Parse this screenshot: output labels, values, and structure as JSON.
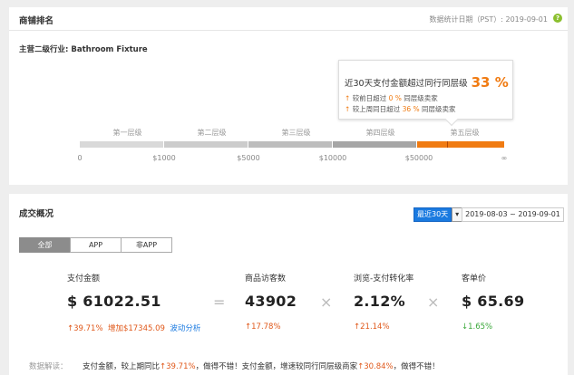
{
  "shop_rank": {
    "title": "商铺排名",
    "stat_date": "数据统计日期（PST）: 2019-09-01",
    "industry": "主营二级行业: Bathroom Fixture",
    "popup": {
      "main": "近30天支付金额超过同行同层级",
      "pct": "33 %",
      "line1_prefix": "较前日超过",
      "line1_pct": "0 %",
      "line1_suffix": "同层级卖家",
      "line2_prefix": "较上周同日超过",
      "line2_pct": "36 %",
      "line2_suffix": "同层级卖家"
    },
    "tiers": [
      "第一层级",
      "第二层级",
      "第三层级",
      "第四层级",
      "第五层级"
    ],
    "tier_colors": [
      "#d9d9d9",
      "#cccccc",
      "#bdbdbd",
      "#a6a6a6",
      "#f07b12"
    ],
    "active_tier": "第五层级",
    "ticks": [
      "0",
      "$1000",
      "$5000",
      "$10000",
      "$50000",
      "∞"
    ]
  },
  "deal": {
    "title": "成交概况",
    "period_btn": "最近30天",
    "date_range": "2019-08-03 ~ 2019-09-01",
    "tabs": [
      "全部",
      "APP",
      "非APP"
    ],
    "active_tab": "全部",
    "metrics": {
      "pay_amount": {
        "label": "支付金额",
        "value": "$ 61022.51",
        "change": "↑39.71%",
        "extra": "增加$17345.09",
        "link": "波动分析"
      },
      "visitors": {
        "label": "商品访客数",
        "value": "43902",
        "change": "↑17.78%"
      },
      "conversion": {
        "label": "浏览-支付转化率",
        "value": "2.12%",
        "change": "↑21.14%"
      },
      "unit_price": {
        "label": "客单价",
        "value": "$ 65.69",
        "change": "↓1.65%"
      }
    },
    "operators": {
      "eq": "=",
      "times1": "×",
      "times2": "×"
    },
    "interpretation": {
      "label": "数据解读：",
      "line1_a": "支付金额，较上期同比",
      "line1_b": "↑39.71%",
      "line1_c": "，做得不错！支付金额，增速较同行同层级商家",
      "line1_d": "↑30.84%",
      "line1_e": "，做得不错！"
    }
  },
  "colors": {
    "accent": "#f07b12",
    "up": "#e0581a",
    "down": "#3aa83a",
    "link": "#1a7ae0"
  }
}
